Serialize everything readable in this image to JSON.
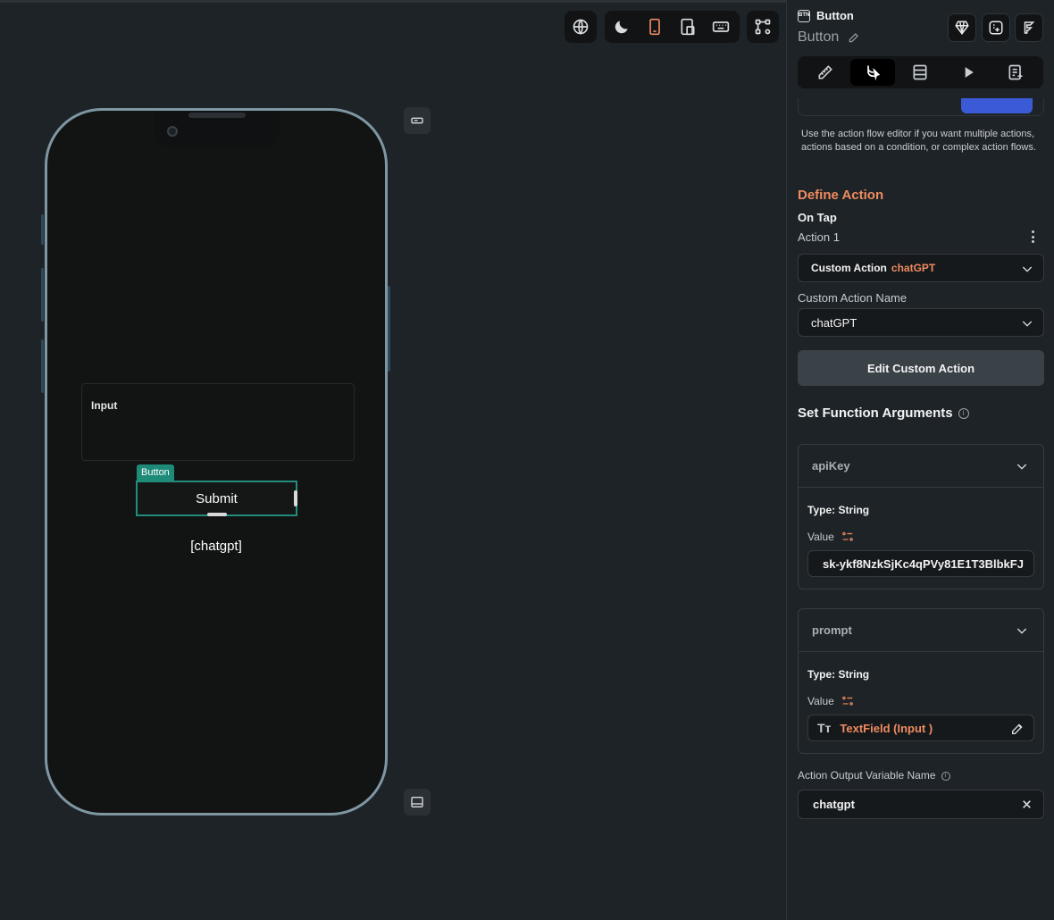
{
  "canvas": {
    "phone": {
      "input_label": "Input",
      "button_tag": "Button",
      "button_text": "Submit",
      "output_text": "[chatgpt]"
    },
    "toolbar": {
      "icons": [
        "globe-icon",
        "moon-icon",
        "phone-icon",
        "tablet-icon",
        "keyboard-icon",
        "tree-icon"
      ],
      "active": "phone-icon",
      "active_color": "#ee8b60"
    }
  },
  "panel": {
    "widget_type": "Button",
    "widget_name": "Button",
    "tabs": [
      "properties-tab",
      "actions-tab",
      "backend-query-tab",
      "preview-tab",
      "docs-tab"
    ],
    "active_tab": "actions-tab",
    "help_text": "Use the action flow editor if you want multiple actions, actions based on a condition, or complex action flows.",
    "define_action_title": "Define Action",
    "trigger": "On Tap",
    "action_label": "Action 1",
    "action_type_label": "Custom Action",
    "action_type_value": "chatGPT",
    "custom_action_name_label": "Custom Action Name",
    "custom_action_name_value": "chatGPT",
    "edit_button": "Edit Custom Action",
    "set_args_title": "Set Function Arguments",
    "args": [
      {
        "name": "apiKey",
        "type": "Type: String",
        "value_label": "Value",
        "value": "sk-ykf8NzkSjKc4qPVy81E1T3BlbkFJ"
      },
      {
        "name": "prompt",
        "type": "Type: String",
        "value_label": "Value",
        "value": "TextField (Input )"
      }
    ],
    "output_label": "Action Output Variable Name",
    "output_value": "chatgpt",
    "accent": "#ee8b60"
  }
}
